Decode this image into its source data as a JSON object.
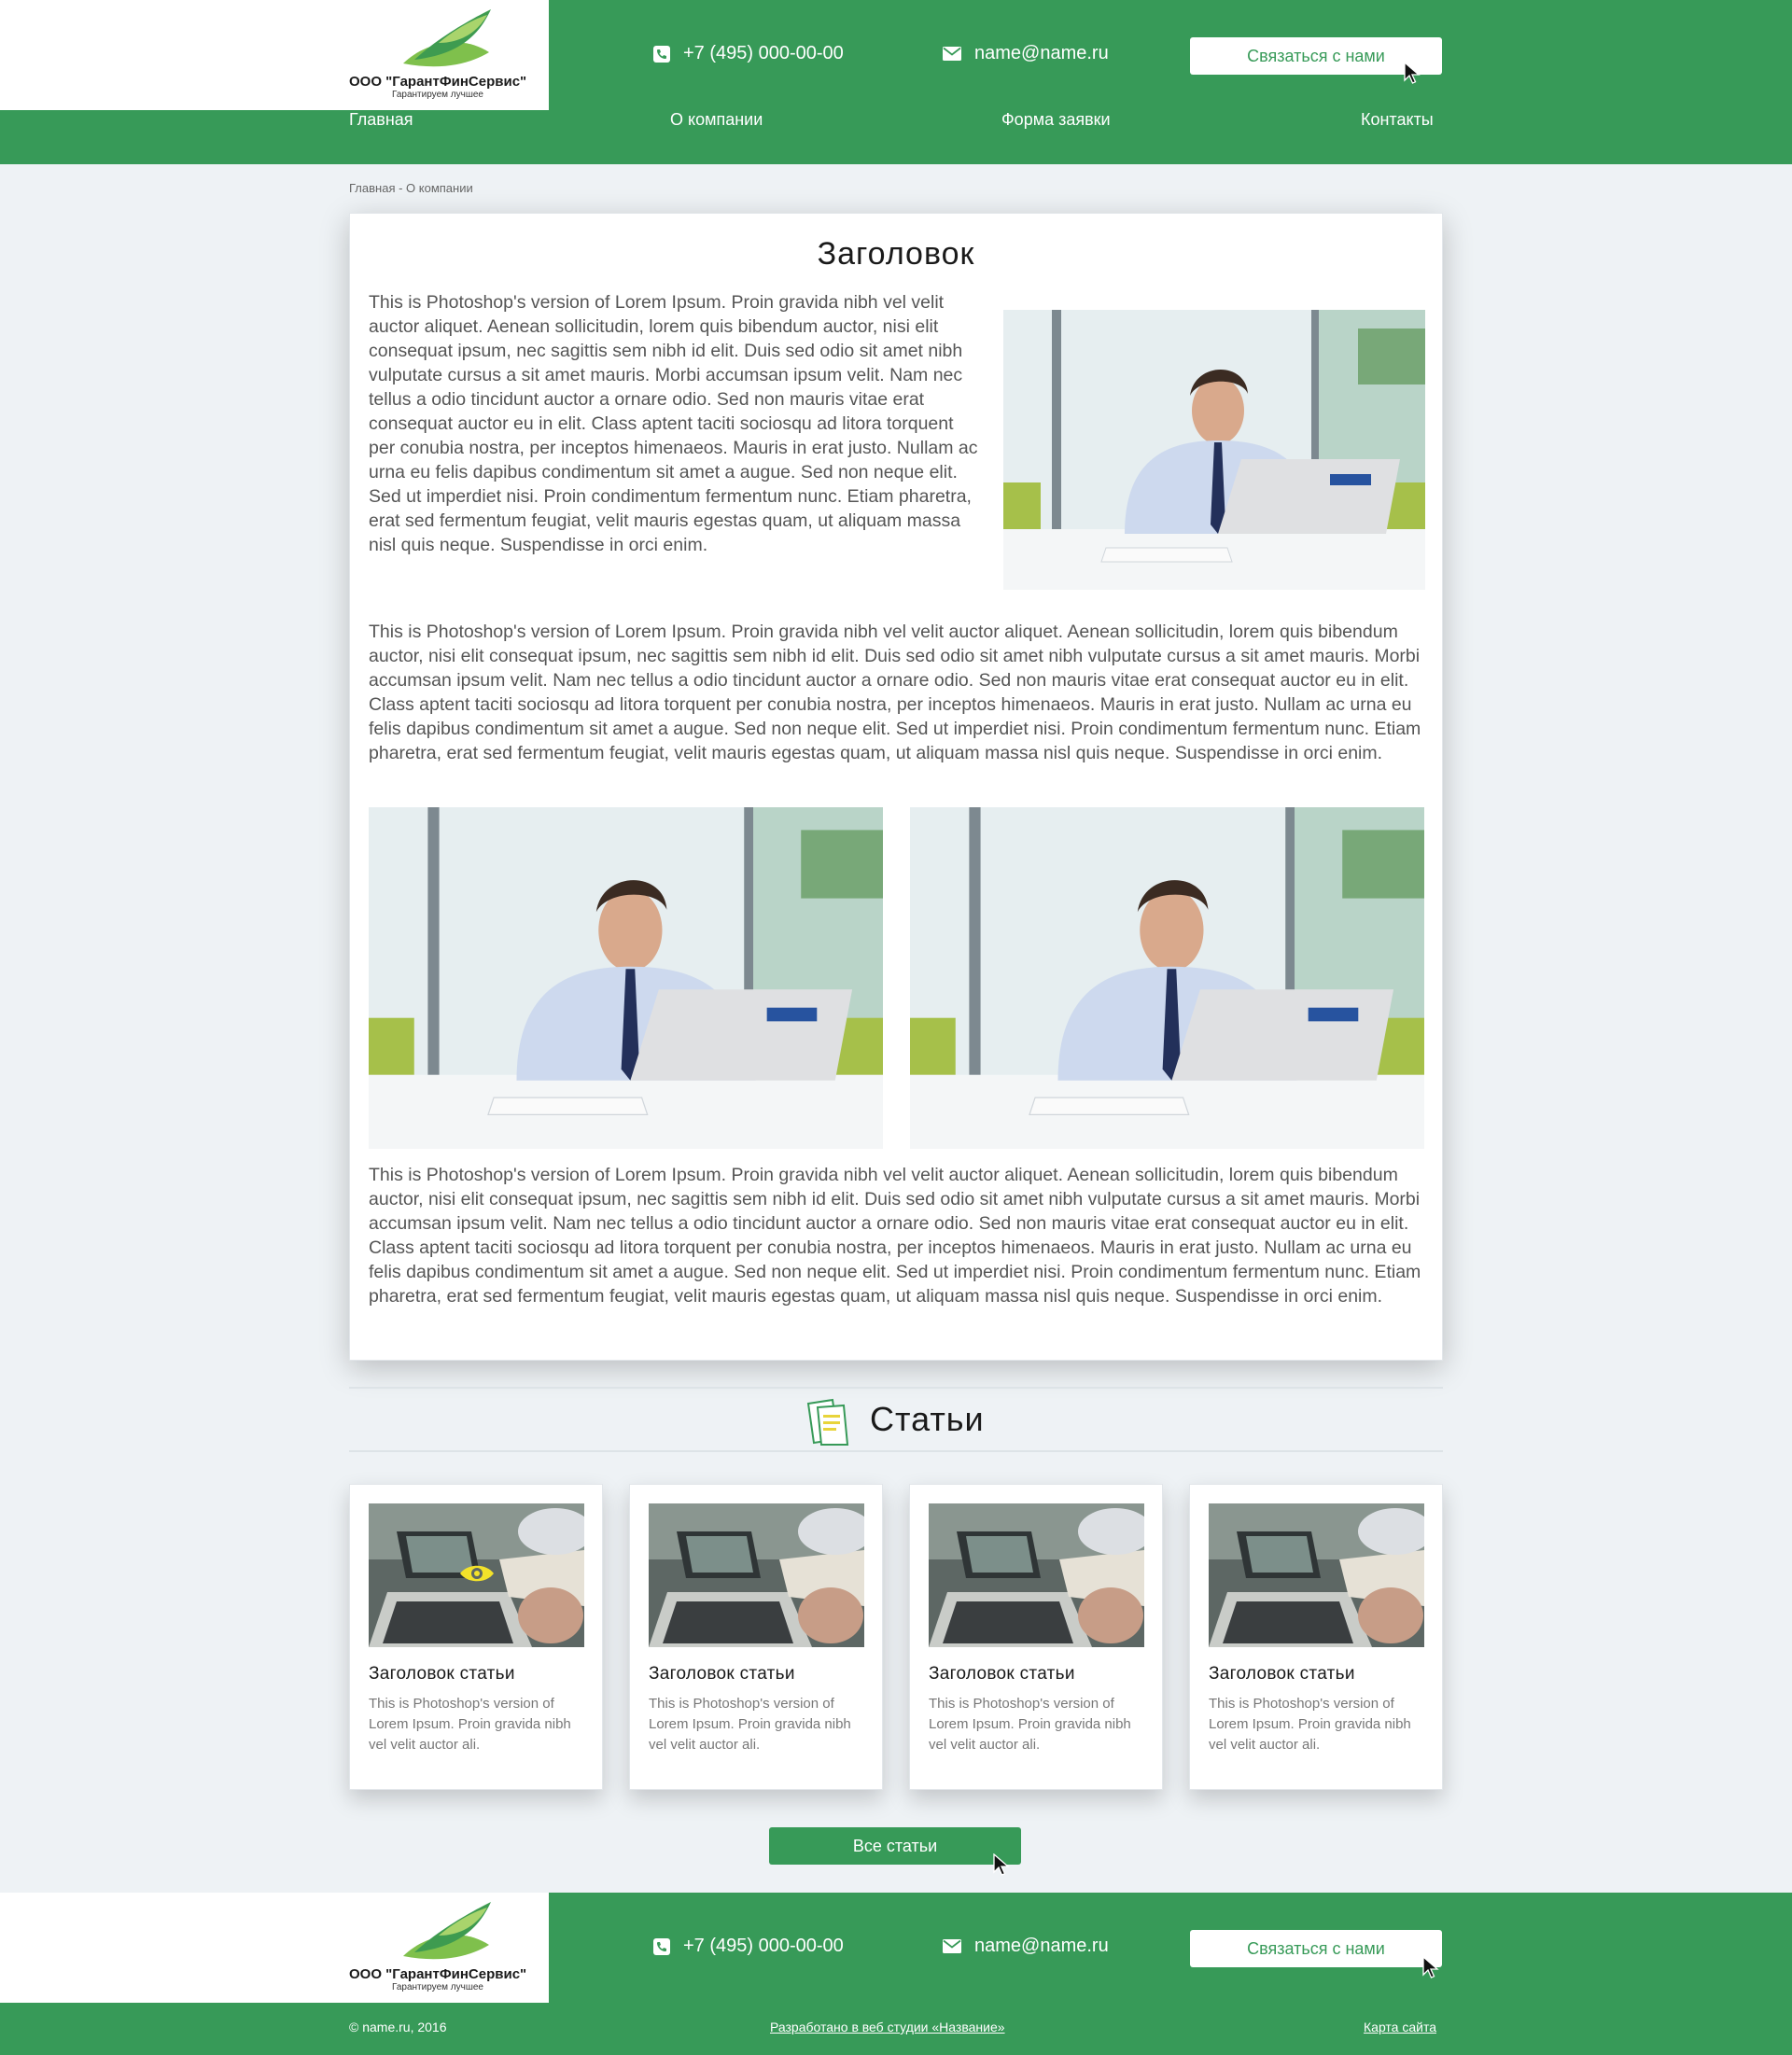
{
  "header": {
    "company_name": "ООО \"ГарантФинСервис\"",
    "tagline": "Гарантируем лучшее",
    "phone": "+7 (495) 000-00-00",
    "email": "name@name.ru",
    "contact_button": "Связаться с нами"
  },
  "nav": {
    "items": [
      {
        "label": "Главная"
      },
      {
        "label": "О компании"
      },
      {
        "label": "Форма заявки"
      },
      {
        "label": "Контакты"
      }
    ]
  },
  "breadcrumb": "Главная - О компании",
  "article": {
    "title": "Заголовок",
    "para1": "This is Photoshop's version  of Lorem Ipsum. Proin gravida nibh vel velit auctor aliquet. Aenean sollicitudin, lorem quis bibendum auctor, nisi elit consequat ipsum, nec sagittis sem nibh id elit. Duis sed odio sit amet nibh vulputate cursus a sit amet mauris. Morbi accumsan ipsum velit. Nam nec tellus a odio tincidunt auctor a ornare odio. Sed non  mauris vitae erat consequat auctor eu in elit. Class aptent taciti sociosqu ad litora torquent per conubia nostra, per inceptos himenaeos. Mauris in erat justo. Nullam ac urna eu felis dapibus condimentum sit amet a augue. Sed non neque elit. Sed ut imperdiet nisi. Proin condimentum fermentum nunc. Etiam pharetra, erat sed fermentum feugiat, velit mauris egestas quam, ut aliquam massa nisl quis neque. Suspendisse in orci enim.",
    "para2": "This is Photoshop's version  of Lorem Ipsum. Proin gravida nibh vel velit auctor aliquet. Aenean sollicitudin, lorem quis bibendum auctor, nisi elit consequat ipsum, nec sagittis sem nibh id elit. Duis sed odio sit amet nibh vulputate cursus a sit amet mauris. Morbi accumsan ipsum velit. Nam nec tellus a odio tincidunt auctor a ornare odio. Sed non mauris vitae erat consequat auctor eu in elit. Class aptent taciti sociosqu ad litora torquent per conubia nostra, per inceptos himenaeos. Mauris in erat justo. Nullam ac urna eu felis dapibus condimentum sit amet a augue. Sed non neque elit. Sed ut imperdiet nisi. Proin condimentum fermentum nunc. Etiam pharetra, erat sed fermentum feugiat, velit mauris egestas quam, ut aliquam massa nisl quis neque. Suspendisse in orci enim.",
    "para3": "This is Photoshop's version  of Lorem Ipsum. Proin gravida nibh vel velit auctor aliquet. Aenean sollicitudin, lorem quis bibendum auctor, nisi elit consequat ipsum, nec sagittis sem nibh id elit. Duis sed odio sit amet nibh vulputate cursus a sit amet mauris. Morbi accumsan ipsum velit. Nam nec tellus a odio tincidunt auctor a ornare odio. Sed non mauris vitae erat consequat auctor eu in elit. Class aptent taciti sociosqu ad litora torquent per conubia nostra, per inceptos himenaeos. Mauris in erat justo. Nullam ac urna eu felis dapibus condimentum sit amet a augue. Sed non neque elit. Sed ut imperdiet nisi. Proin condimentum fermentum nunc. Etiam pharetra, erat sed fermentum feugiat, velit mauris egestas quam, ut aliquam massa nisl quis neque. Suspendisse in orci enim."
  },
  "articles_section": {
    "title": "Статьи",
    "cards": [
      {
        "title": "Заголовок статьи",
        "text": "This is Photoshop's version of Lorem Ipsum. Proin gravida nibh vel velit auctor ali."
      },
      {
        "title": "Заголовок статьи",
        "text": "This is Photoshop's version of Lorem Ipsum. Proin gravida nibh vel velit auctor ali."
      },
      {
        "title": "Заголовок статьи",
        "text": "This is Photoshop's version of Lorem Ipsum. Proin gravida nibh vel velit auctor ali."
      },
      {
        "title": "Заголовок статьи",
        "text": "This is Photoshop's version of Lorem Ipsum. Proin gravida nibh vel velit auctor ali."
      }
    ],
    "all_button": "Все статьи"
  },
  "footer": {
    "company_name": "ООО \"ГарантФинСервис\"",
    "tagline": "Гарантируем лучшее",
    "phone": "+7 (495) 000-00-00",
    "email": "name@name.ru",
    "contact_button": "Связаться с нами",
    "copyright": "©  name.ru, 2016",
    "developer_link": "Разработано в веб студии «Название»",
    "sitemap_link": "Карта сайта"
  },
  "colors": {
    "brand_green": "#379a58",
    "background": "#eef2f5"
  },
  "icons": [
    "logo-leaf-icon",
    "phone-icon",
    "mail-icon",
    "cursor-icon",
    "articles-icon",
    "eye-icon"
  ]
}
